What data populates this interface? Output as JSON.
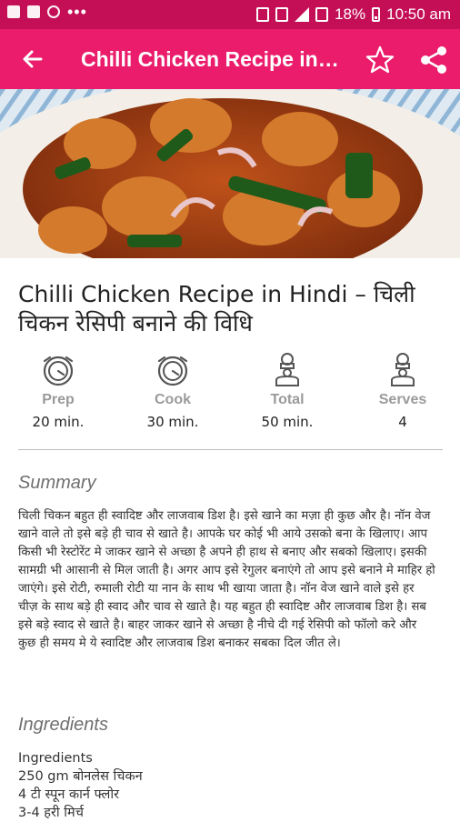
{
  "status_bar": {
    "battery": "18%",
    "time": "10:50 am"
  },
  "toolbar": {
    "title": "Chilli Chicken Recipe in Hindi – चिली चिकन रेसिपी बनाने की विधि"
  },
  "recipe": {
    "title": "Chilli Chicken Recipe in Hindi – चिली चिकन रेसिपी बनाने की विधि"
  },
  "stats": [
    {
      "label": "Prep",
      "value": "20 min.",
      "icon": "timer-icon"
    },
    {
      "label": "Cook",
      "value": "30 min.",
      "icon": "timer-icon"
    },
    {
      "label": "Total",
      "value": "50 min.",
      "icon": "chef-icon"
    },
    {
      "label": "Serves",
      "value": "4",
      "icon": "chef-icon"
    }
  ],
  "summary": {
    "heading": "Summary",
    "text": "चिली चिकन बहुत ही स्वादिष्ट और लाजवाब डिश है। इसे खाने का मज़ा ही कुछ और है। नॉन वेज खाने वाले तो इसे बड़े ही चाव से खाते है। आपके घर कोई भी आये उसको बना के खिलाए। आप किसी भी रेस्टोरेंट मे जाकर खाने से अच्छा है अपने ही हाथ से बनाए और सबको खिलाए। इसकी सामग्री भी आसानी से मिल जाती है। अगर आप इसे रेगुलर बनाएंगे तो आप इसे बनाने मे माहिर हो जाएंगे। इसे रोटी, रुमाली रोटी या नान के साथ भी खाया जाता है। नॉन वेज खाने वाले इसे हर चीज़ के साथ बड़े ही स्वाद और चाव से खाते है। यह बहुत ही स्वादिष्ट और लाजवाब डिश है। सब इसे बड़े स्वाद से खाते है। बाहर जाकर खाने से अच्छा है नीचे दी गई रेसिपी को फॉलो करे और कुछ ही समय मे ये स्वादिष्ट और लाजवाब डिश बनाकर सबका दिल जीत ले।"
  },
  "ingredients": {
    "heading": "Ingredients",
    "lines": [
      "Ingredients",
      "250 gm बोनलेस चिकन",
      "4 टी स्पून कार्न फ्लोर",
      "3-4 हरी मिर्च"
    ]
  },
  "colors": {
    "status_bar": "#c40f57",
    "app_bar": "#ea1c6b"
  }
}
